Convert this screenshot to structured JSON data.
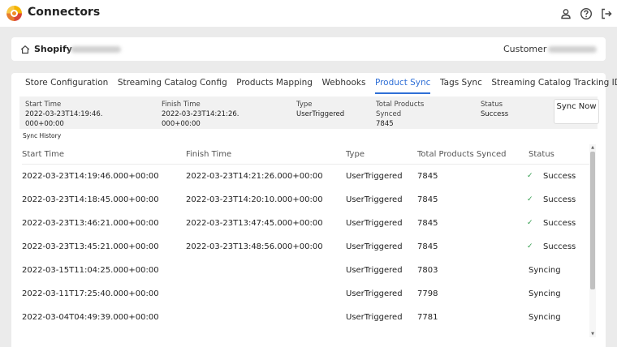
{
  "app": {
    "title": "Connectors"
  },
  "store": {
    "name": "Shopify",
    "customer_label": "Customer"
  },
  "tabs": [
    {
      "label": "Store Configuration"
    },
    {
      "label": "Streaming Catalog Config"
    },
    {
      "label": "Products Mapping"
    },
    {
      "label": "Webhooks"
    },
    {
      "label": "Product Sync",
      "active": true
    },
    {
      "label": "Tags Sync"
    },
    {
      "label": "Streaming Catalog Tracking ID's"
    }
  ],
  "summary": {
    "start_time_label": "Start Time",
    "start_time_value": "2022-03-23T14:19:46.000+00:00",
    "finish_time_label": "Finish Time",
    "finish_time_value": "2022-03-23T14:21:26.000+00:00",
    "type_label": "Type",
    "type_value": "UserTriggered",
    "total_label": "Total Products Synced",
    "total_value": "7845",
    "status_label": "Status",
    "status_value": "Success",
    "sync_now_label": "Sync Now"
  },
  "history": {
    "label": "Sync History",
    "columns": [
      "Start Time",
      "Finish Time",
      "Type",
      "Total Products Synced",
      "Status"
    ],
    "rows": [
      {
        "start": "2022-03-23T14:19:46.000+00:00",
        "finish": "2022-03-23T14:21:26.000+00:00",
        "type": "UserTriggered",
        "total": "7845",
        "status": "Success",
        "check": "✓"
      },
      {
        "start": "2022-03-23T14:18:45.000+00:00",
        "finish": "2022-03-23T14:20:10.000+00:00",
        "type": "UserTriggered",
        "total": "7845",
        "status": "Success",
        "check": "✓"
      },
      {
        "start": "2022-03-23T13:46:21.000+00:00",
        "finish": "2022-03-23T13:47:45.000+00:00",
        "type": "UserTriggered",
        "total": "7845",
        "status": "Success",
        "check": "✓"
      },
      {
        "start": "2022-03-23T13:45:21.000+00:00",
        "finish": "2022-03-23T13:48:56.000+00:00",
        "type": "UserTriggered",
        "total": "7845",
        "status": "Success",
        "check": "✓"
      },
      {
        "start": "2022-03-15T11:04:25.000+00:00",
        "finish": "",
        "type": "UserTriggered",
        "total": "7803",
        "status": "Syncing",
        "check": ""
      },
      {
        "start": "2022-03-11T17:25:40.000+00:00",
        "finish": "",
        "type": "UserTriggered",
        "total": "7798",
        "status": "Syncing",
        "check": ""
      },
      {
        "start": "2022-03-04T04:49:39.000+00:00",
        "finish": "",
        "type": "UserTriggered",
        "total": "7781",
        "status": "Syncing",
        "check": ""
      }
    ]
  },
  "icons": {
    "user": "user-icon",
    "help": "help-icon",
    "logout": "logout-icon",
    "home": "home-icon",
    "success": "check-icon"
  },
  "colors": {
    "accent": "#2f6fd6",
    "success": "#2e9a4a",
    "background": "#ebebeb"
  }
}
